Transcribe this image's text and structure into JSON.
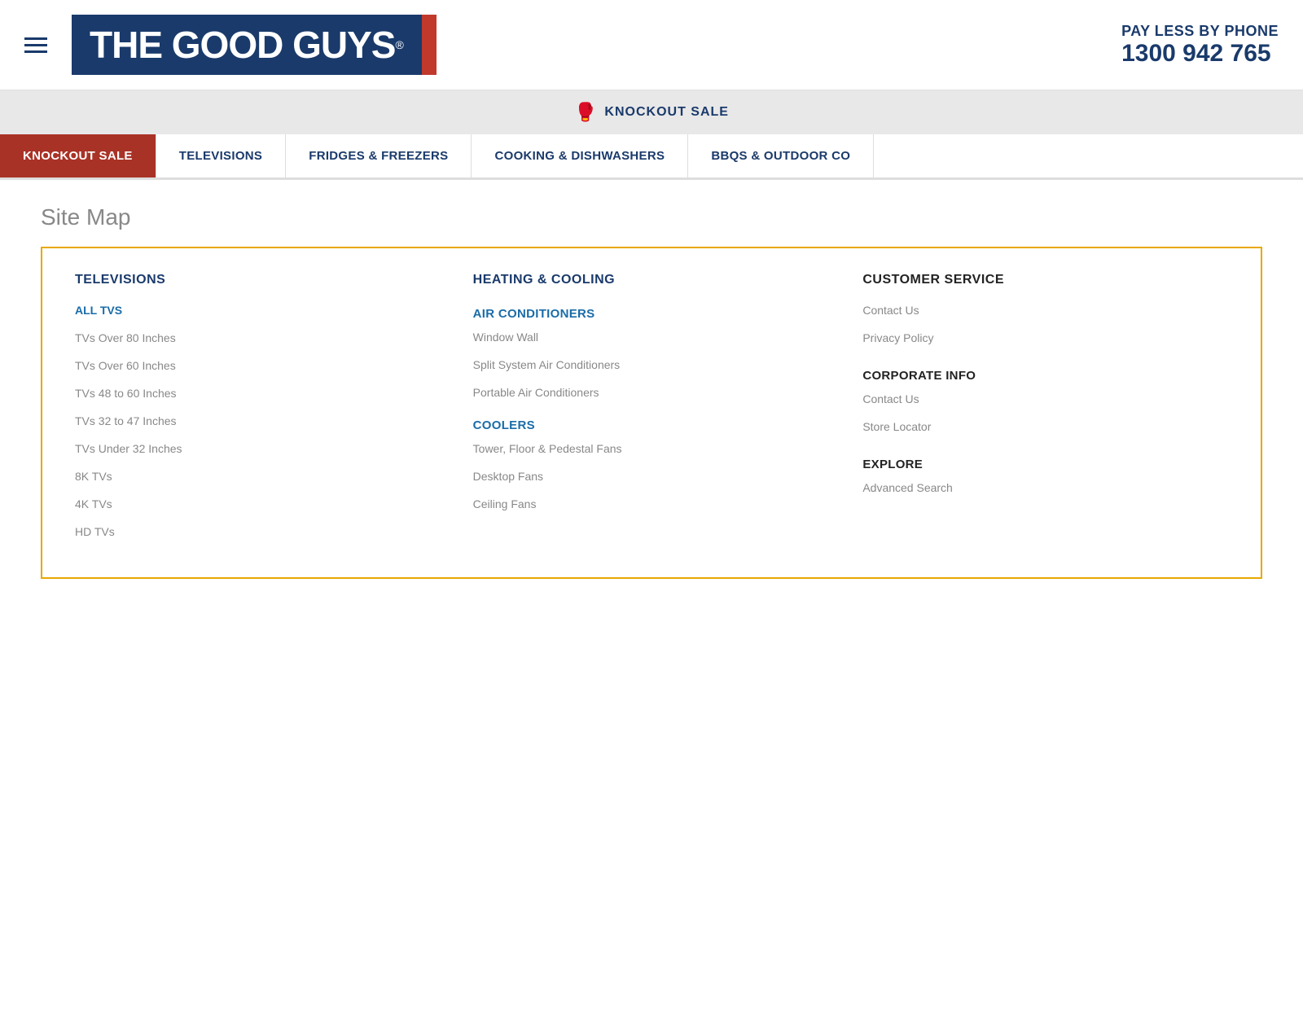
{
  "header": {
    "pay_less_label": "PAY LESS BY PHONE",
    "phone_number": "1300 942 765",
    "logo_text": "THE GOOD GUYS"
  },
  "promo_bar": {
    "text": "KNOCKOUT SALE",
    "icon": "🥊"
  },
  "nav": {
    "items": [
      {
        "label": "KNOCKOUT SALE",
        "active": true
      },
      {
        "label": "TELEVISIONS",
        "active": false
      },
      {
        "label": "FRIDGES & FREEZERS",
        "active": false
      },
      {
        "label": "COOKING & DISHWASHERS",
        "active": false
      },
      {
        "label": "BBQS & OUTDOOR CO",
        "active": false
      }
    ]
  },
  "sitemap": {
    "title": "Site Map",
    "columns": [
      {
        "header": "TELEVISIONS",
        "header_style": "blue",
        "items": [
          {
            "label": "ALL TVS",
            "style": "bold-link"
          },
          {
            "label": "TVs Over 80 Inches",
            "style": "normal"
          },
          {
            "label": "TVs Over 60 Inches",
            "style": "normal"
          },
          {
            "label": "TVs 48 to 60 Inches",
            "style": "normal"
          },
          {
            "label": "TVs 32 to 47 Inches",
            "style": "normal"
          },
          {
            "label": "TVs Under 32 Inches",
            "style": "normal"
          },
          {
            "label": "8K TVs",
            "style": "normal"
          },
          {
            "label": "4K TVs",
            "style": "faded"
          },
          {
            "label": "HD TVs",
            "style": "faded"
          }
        ]
      },
      {
        "header": "HEATING & COOLING",
        "header_style": "blue",
        "subsections": [
          {
            "label": "AIR CONDITIONERS",
            "items": [
              {
                "label": "Window Wall"
              },
              {
                "label": "Split System Air Conditioners"
              },
              {
                "label": "Portable Air Conditioners"
              }
            ]
          },
          {
            "label": "COOLERS",
            "items": [
              {
                "label": "Tower, Floor & Pedestal Fans"
              },
              {
                "label": "Desktop Fans"
              },
              {
                "label": "Ceiling Fans"
              }
            ]
          }
        ]
      },
      {
        "header": "CUSTOMER SERVICE",
        "header_style": "dark",
        "items": [
          {
            "label": "Contact Us",
            "style": "normal"
          },
          {
            "label": "Privacy Policy",
            "style": "normal"
          }
        ],
        "subsections": [
          {
            "label": "CORPORATE INFO",
            "style": "dark",
            "items": [
              {
                "label": "Contact Us"
              },
              {
                "label": "Store Locator"
              }
            ]
          },
          {
            "label": "EXPLORE",
            "style": "dark",
            "items": [
              {
                "label": "Advanced Search"
              }
            ]
          }
        ]
      }
    ]
  }
}
